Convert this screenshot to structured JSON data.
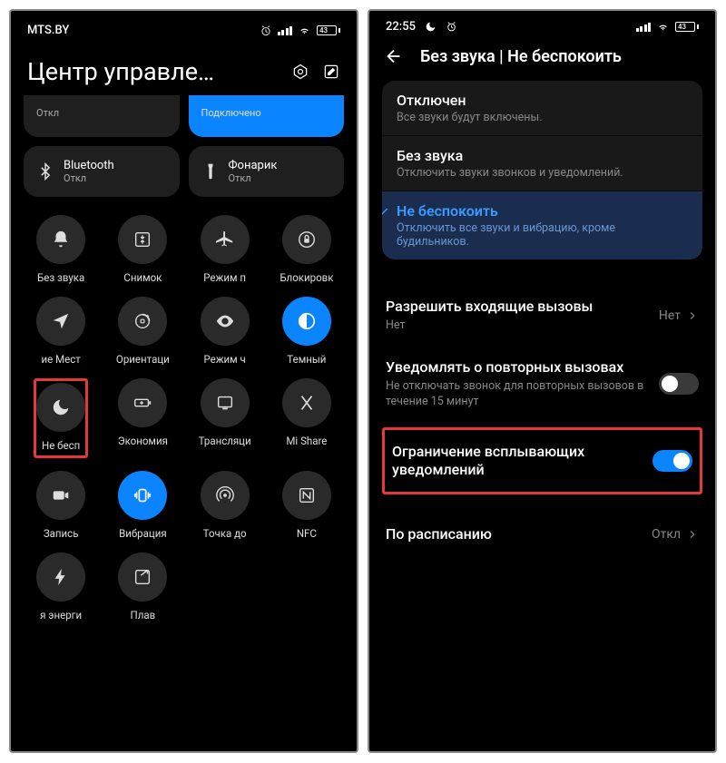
{
  "left": {
    "status": {
      "carrier": "MTS.BY",
      "battery": "43"
    },
    "header": {
      "title": "Центр управле…"
    },
    "wide_row1": {
      "left_sub": "Откл",
      "right_sub": "Подключено"
    },
    "wide_row2": {
      "bt": {
        "title": "Bluetooth",
        "sub": "Откл"
      },
      "flash": {
        "title": "Фонарик",
        "sub": "Откл"
      }
    },
    "toggles": [
      [
        {
          "name": "mute",
          "label": "Без звука",
          "active": false,
          "icon": "bell"
        },
        {
          "name": "screenshot",
          "label": "Снимок",
          "active": false,
          "icon": "screenshot"
        },
        {
          "name": "airplane",
          "label": "Режим п",
          "active": false,
          "icon": "airplane"
        },
        {
          "name": "lock",
          "label": "Блокировк",
          "active": false,
          "icon": "lock"
        }
      ],
      [
        {
          "name": "location",
          "label": "ие   Мест",
          "active": false,
          "icon": "location"
        },
        {
          "name": "rotation",
          "label": "Ориентаци",
          "active": false,
          "icon": "rotation"
        },
        {
          "name": "eye",
          "label": "Режим ч",
          "active": false,
          "icon": "eye"
        },
        {
          "name": "dark",
          "label": "Темный",
          "active": true,
          "icon": "darkmode"
        }
      ],
      [
        {
          "name": "dnd",
          "label": "Не бесп",
          "active": false,
          "icon": "moon",
          "highlight": true
        },
        {
          "name": "battery",
          "label": "Экономия",
          "active": false,
          "icon": "batteryplus"
        },
        {
          "name": "cast",
          "label": "Трансляци",
          "active": false,
          "icon": "cast"
        },
        {
          "name": "mishare",
          "label": "Mi Share",
          "active": false,
          "icon": "mishare"
        }
      ],
      [
        {
          "name": "record",
          "label": "Запись",
          "active": false,
          "icon": "record"
        },
        {
          "name": "vibrate",
          "label": "Вибрация",
          "active": true,
          "icon": "vibrate"
        },
        {
          "name": "hotspot",
          "label": "Точка до",
          "active": false,
          "icon": "hotspot"
        },
        {
          "name": "nfc",
          "label": "NFC",
          "active": false,
          "icon": "nfc"
        }
      ],
      [
        {
          "name": "energy",
          "label": "я энерги",
          "active": false,
          "icon": "bolt"
        },
        {
          "name": "float",
          "label": "Плав",
          "active": false,
          "icon": "float"
        }
      ]
    ]
  },
  "right": {
    "status": {
      "time": "22:55",
      "battery": "43"
    },
    "page_title": "Без звука | Не беспокоить",
    "options": [
      {
        "title": "Отключен",
        "desc": "Все звуки будут включены.",
        "selected": false
      },
      {
        "title": "Без звука",
        "desc": "Отключить звуки звонков и уведомлений.",
        "selected": false
      },
      {
        "title": "Не беспокоить",
        "desc": "Отключить все звуки и вибрацию, кроме будильников.",
        "selected": true
      }
    ],
    "settings": {
      "incoming": {
        "title": "Разрешить входящие вызовы",
        "value": "Нет",
        "desc": ""
      },
      "repeat": {
        "title": "Уведомлять о повторных вызовах",
        "desc": "Не отключать звонок для повторных вызовов в течение 15 минут",
        "on": false
      },
      "popup": {
        "title": "Ограничение всплывающих уведомлений",
        "on": true,
        "highlight": true
      },
      "schedule": {
        "title": "По расписанию",
        "value": "Откл"
      }
    }
  }
}
